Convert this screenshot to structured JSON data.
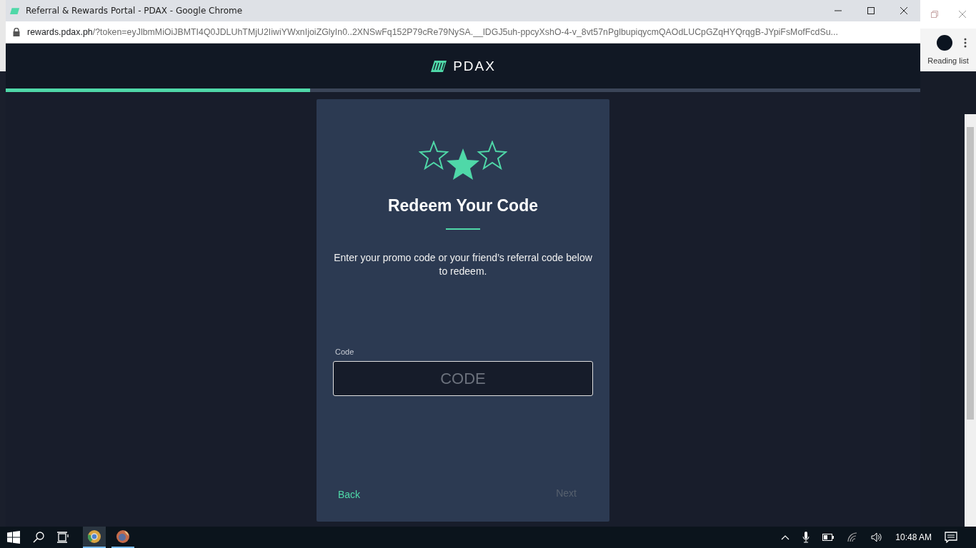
{
  "window": {
    "title": "Referral & Rewards Portal - PDAX - Google Chrome",
    "url_host": "rewards.pdax.ph",
    "url_rest": "/?token=eyJlbmMiOiJBMTI4Q0JDLUhTMjU2IiwiYWxnIjoiZGlyIn0..2XNSwFq152P79cRe79NySA.__lDGJ5uh-ppcyXshO-4-v_8vt57nPglbupiqycmQAOdLUCpGZqHYQrqgB-JYpiFsMofFcdSu..."
  },
  "header": {
    "brand": "PDAX"
  },
  "progress": {
    "level": 0.333
  },
  "card": {
    "title": "Redeem Your Code",
    "description": "Enter your promo code or your friend’s referral code below to redeem.",
    "field": {
      "label": "Code",
      "placeholder": "CODE"
    },
    "back": {
      "label": "Back",
      "disabled": false
    },
    "next": {
      "label": "Next",
      "disabled": true
    }
  },
  "background_window": {
    "toolbar_label": "Reading list"
  },
  "taskbar": {
    "apps": [
      {
        "kind": "chrome",
        "selected": true
      },
      {
        "kind": "firefox",
        "selected": false
      }
    ],
    "clock": "10:48 AM"
  }
}
